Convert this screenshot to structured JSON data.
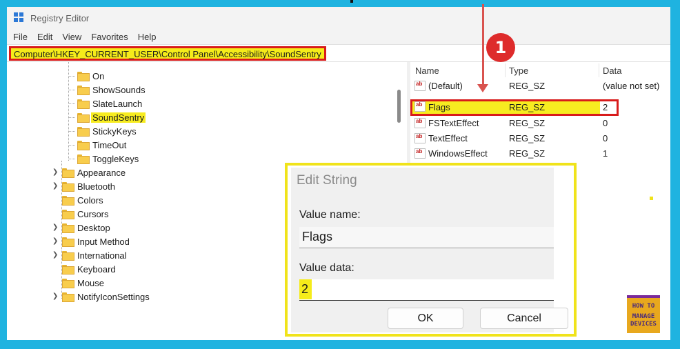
{
  "window": {
    "title": "Registry Editor"
  },
  "menu": [
    "File",
    "Edit",
    "View",
    "Favorites",
    "Help"
  ],
  "address": "Computer\\HKEY_CURRENT_USER\\Control Panel\\Accessibility\\SoundSentry",
  "tree": {
    "subkeys": [
      "On",
      "ShowSounds",
      "SlateLaunch",
      "SoundSentry",
      "StickyKeys",
      "TimeOut",
      "ToggleKeys"
    ],
    "selected": "SoundSentry",
    "siblings": [
      {
        "label": "Appearance",
        "expandable": true
      },
      {
        "label": "Bluetooth",
        "expandable": true
      },
      {
        "label": "Colors",
        "expandable": false
      },
      {
        "label": "Cursors",
        "expandable": false
      },
      {
        "label": "Desktop",
        "expandable": true
      },
      {
        "label": "Input Method",
        "expandable": true
      },
      {
        "label": "International",
        "expandable": true
      },
      {
        "label": "Keyboard",
        "expandable": false
      },
      {
        "label": "Mouse",
        "expandable": false
      },
      {
        "label": "NotifyIconSettings",
        "expandable": true
      }
    ]
  },
  "values": {
    "headers": {
      "name": "Name",
      "type": "Type",
      "data": "Data"
    },
    "rows": [
      {
        "name": "(Default)",
        "type": "REG_SZ",
        "data": "(value not set)"
      },
      {
        "name": "Flags",
        "type": "REG_SZ",
        "data": "2"
      },
      {
        "name": "FSTextEffect",
        "type": "REG_SZ",
        "data": "0"
      },
      {
        "name": "TextEffect",
        "type": "REG_SZ",
        "data": "0"
      },
      {
        "name": "WindowsEffect",
        "type": "REG_SZ",
        "data": "1"
      }
    ]
  },
  "callout": {
    "number": "1"
  },
  "dialog": {
    "title": "Edit String",
    "value_name_label": "Value name:",
    "value_name": "Flags",
    "value_data_label": "Value data:",
    "value_data": "2",
    "ok_label": "OK",
    "cancel_label": "Cancel"
  },
  "logo": {
    "line1": "HOW TO",
    "line2": "MANAGE",
    "line3": "DEVICES"
  },
  "colors": {
    "highlight_red": "#d81b1b",
    "highlight_yellow": "#f5ec1a",
    "frame_blue": "#1fb3e0"
  }
}
